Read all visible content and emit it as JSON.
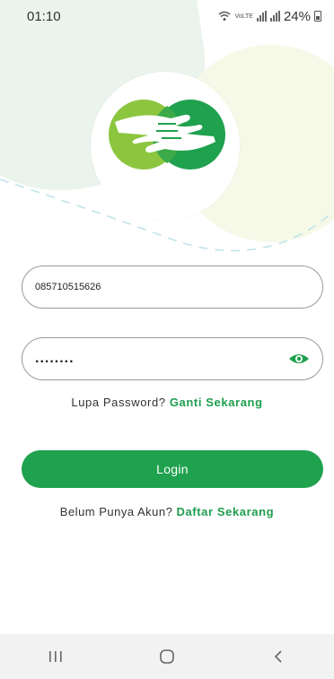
{
  "status_bar": {
    "time": "01:10",
    "network_label": "VoLTE",
    "battery": "24%"
  },
  "login_form": {
    "phone_value": "085710515626",
    "password_value": "........",
    "password_toggle_icon": "eye-icon"
  },
  "forgot_password": {
    "prompt": "Lupa Password?",
    "link": "Ganti Sekarang"
  },
  "login_button": {
    "label": "Login"
  },
  "register": {
    "prompt": "Belum Punya Akun?",
    "link": "Daftar Sekarang"
  },
  "navigation": {
    "recent_icon": "recent-apps-icon",
    "home_icon": "home-icon",
    "back_icon": "back-icon"
  },
  "colors": {
    "accent": "#1fa14e",
    "logo_light_green": "#8cc63f",
    "logo_dark_green": "#1fa14e"
  }
}
